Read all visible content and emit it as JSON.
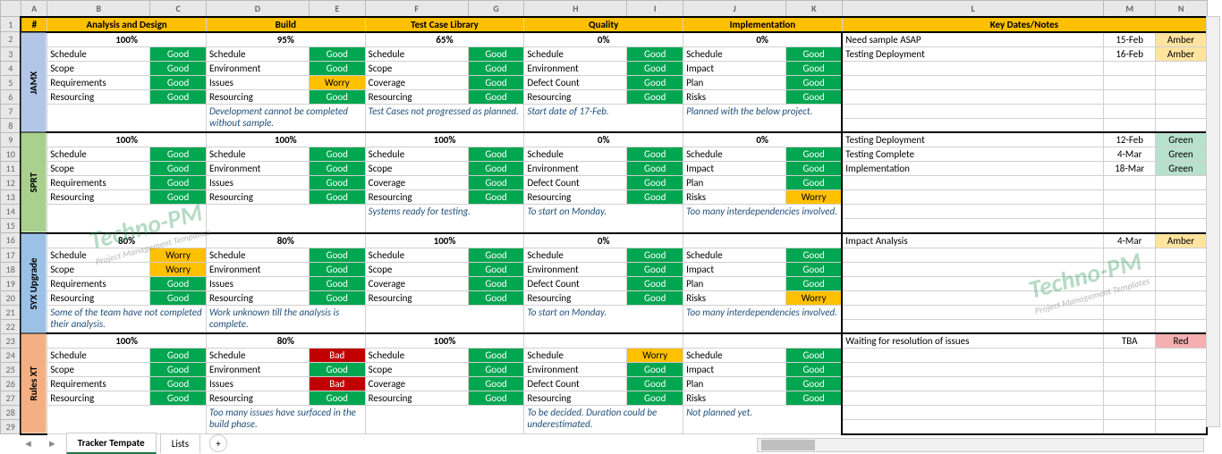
{
  "sheet": {
    "columns": [
      "",
      "A",
      "B",
      "C",
      "D",
      "E",
      "F",
      "G",
      "H",
      "I",
      "J",
      "K",
      "L",
      "M",
      "N"
    ],
    "headers": {
      "a": "#",
      "analysis": "Analysis and Design",
      "build": "Build",
      "testcase": "Test Case Library",
      "quality": "Quality",
      "implementation": "Implementation",
      "keydates": "Key Dates/Notes"
    }
  },
  "projects": [
    {
      "name": "JAMX",
      "color": "proj-blue",
      "rows": [
        "2",
        "3",
        "4",
        "5",
        "6",
        "7",
        "8"
      ],
      "pct": [
        "100%",
        "95%",
        "65%",
        "0%",
        "0%"
      ],
      "items": {
        "analysis": [
          [
            "Schedule",
            "Good"
          ],
          [
            "Scope",
            "Good"
          ],
          [
            "Requirements",
            "Good"
          ],
          [
            "Resourcing",
            "Good"
          ]
        ],
        "build": [
          [
            "Schedule",
            "Good"
          ],
          [
            "Environment",
            "Good"
          ],
          [
            "Issues",
            "Worry"
          ],
          [
            "Resourcing",
            "Good"
          ]
        ],
        "testcase": [
          [
            "Schedule",
            "Good"
          ],
          [
            "Scope",
            "Good"
          ],
          [
            "Coverage",
            "Good"
          ],
          [
            "Resourcing",
            "Good"
          ]
        ],
        "quality": [
          [
            "Schedule",
            "Good"
          ],
          [
            "Environment",
            "Good"
          ],
          [
            "Defect Count",
            "Good"
          ],
          [
            "Resourcing",
            "Good"
          ]
        ],
        "implementation": [
          [
            "Schedule",
            "Good"
          ],
          [
            "Impact",
            "Good"
          ],
          [
            "Plan",
            "Good"
          ],
          [
            "Risks",
            "Good"
          ]
        ]
      },
      "notes": [
        "",
        "Development cannot be completed without sample.",
        "Test Cases not progressed as planned.",
        "Start date of 17-Feb.",
        "Planned with the below project."
      ],
      "keydates": [
        {
          "label": "Need sample ASAP",
          "date": "15-Feb",
          "status": "Amber"
        },
        {
          "label": "Testing Deployment",
          "date": "16-Feb",
          "status": "Amber"
        }
      ]
    },
    {
      "name": "SPRT",
      "color": "proj-green",
      "rows": [
        "9",
        "10",
        "11",
        "12",
        "13",
        "14",
        "15"
      ],
      "pct": [
        "100%",
        "100%",
        "100%",
        "0%",
        "0%"
      ],
      "items": {
        "analysis": [
          [
            "Schedule",
            "Good"
          ],
          [
            "Scope",
            "Good"
          ],
          [
            "Requirements",
            "Good"
          ],
          [
            "Resourcing",
            "Good"
          ]
        ],
        "build": [
          [
            "Schedule",
            "Good"
          ],
          [
            "Environment",
            "Good"
          ],
          [
            "Issues",
            "Good"
          ],
          [
            "Resourcing",
            "Good"
          ]
        ],
        "testcase": [
          [
            "Schedule",
            "Good"
          ],
          [
            "Scope",
            "Good"
          ],
          [
            "Coverage",
            "Good"
          ],
          [
            "Resourcing",
            "Good"
          ]
        ],
        "quality": [
          [
            "Schedule",
            "Good"
          ],
          [
            "Environment",
            "Good"
          ],
          [
            "Defect Count",
            "Good"
          ],
          [
            "Resourcing",
            "Good"
          ]
        ],
        "implementation": [
          [
            "Schedule",
            "Good"
          ],
          [
            "Impact",
            "Good"
          ],
          [
            "Plan",
            "Good"
          ],
          [
            "Risks",
            "Worry"
          ]
        ]
      },
      "notes": [
        "",
        "",
        "Systems ready for testing.",
        "To start on Monday.",
        "Too many interdependencies involved."
      ],
      "keydates": [
        {
          "label": "Testing Deployment",
          "date": "12-Feb",
          "status": "Green"
        },
        {
          "label": "Testing Complete",
          "date": "4-Mar",
          "status": "Green"
        },
        {
          "label": "Implementation",
          "date": "18-Mar",
          "status": "Green"
        }
      ]
    },
    {
      "name": "SYX Upgrade",
      "color": "proj-lightblue",
      "rows": [
        "16",
        "17",
        "18",
        "19",
        "20",
        "21",
        "22"
      ],
      "pct": [
        "80%",
        "80%",
        "100%",
        "0%",
        ""
      ],
      "items": {
        "analysis": [
          [
            "Schedule",
            "Worry"
          ],
          [
            "Scope",
            "Worry"
          ],
          [
            "Requirements",
            "Good"
          ],
          [
            "Resourcing",
            "Good"
          ]
        ],
        "build": [
          [
            "Schedule",
            "Good"
          ],
          [
            "Environment",
            "Good"
          ],
          [
            "Issues",
            "Good"
          ],
          [
            "Resourcing",
            "Good"
          ]
        ],
        "testcase": [
          [
            "Schedule",
            "Good"
          ],
          [
            "Scope",
            "Good"
          ],
          [
            "Coverage",
            "Good"
          ],
          [
            "Resourcing",
            "Good"
          ]
        ],
        "quality": [
          [
            "Schedule",
            "Good"
          ],
          [
            "Environment",
            "Good"
          ],
          [
            "Defect Count",
            "Good"
          ],
          [
            "Resourcing",
            "Good"
          ]
        ],
        "implementation": [
          [
            "Schedule",
            "Good"
          ],
          [
            "Impact",
            "Good"
          ],
          [
            "Plan",
            "Good"
          ],
          [
            "Risks",
            "Worry"
          ]
        ]
      },
      "notes": [
        "Some of the team have not completed their analysis.",
        "Work unknown till the analysis is complete.",
        "",
        "To start on Monday.",
        "Too many interdependencies involved."
      ],
      "keydates": [
        {
          "label": "Impact Analysis",
          "date": "4-Mar",
          "status": "Amber"
        }
      ]
    },
    {
      "name": "Rules XT",
      "color": "proj-orange",
      "rows": [
        "23",
        "24",
        "25",
        "26",
        "27",
        "28",
        "29"
      ],
      "pct": [
        "100%",
        "80%",
        "100%",
        "",
        ""
      ],
      "items": {
        "analysis": [
          [
            "Schedule",
            "Good"
          ],
          [
            "Scope",
            "Good"
          ],
          [
            "Requirements",
            "Good"
          ],
          [
            "Resourcing",
            "Good"
          ]
        ],
        "build": [
          [
            "Schedule",
            "Bad"
          ],
          [
            "Environment",
            "Good"
          ],
          [
            "Issues",
            "Bad"
          ],
          [
            "Resourcing",
            "Good"
          ]
        ],
        "testcase": [
          [
            "Schedule",
            "Good"
          ],
          [
            "Scope",
            "Good"
          ],
          [
            "Coverage",
            "Good"
          ],
          [
            "Resourcing",
            "Good"
          ]
        ],
        "quality": [
          [
            "Schedule",
            "Worry"
          ],
          [
            "Environment",
            "Good"
          ],
          [
            "Defect Count",
            "Good"
          ],
          [
            "Resourcing",
            "Good"
          ]
        ],
        "implementation": [
          [
            "Schedule",
            "Good"
          ],
          [
            "Impact",
            "Good"
          ],
          [
            "Plan",
            "Good"
          ],
          [
            "Risks",
            "Good"
          ]
        ]
      },
      "notes": [
        "",
        "Too many issues have surfaced in the build phase.",
        "",
        "To be decided. Duration could be underestimated.",
        "Not planned yet."
      ],
      "keydates": [
        {
          "label": "Waiting for resolution of issues",
          "date": "TBA",
          "status": "Red"
        }
      ]
    }
  ],
  "tabs": {
    "active": "Tracker Tempate",
    "other": "Lists"
  },
  "watermark": {
    "main": "Techno-PM",
    "sub": "Project Management Templates"
  }
}
